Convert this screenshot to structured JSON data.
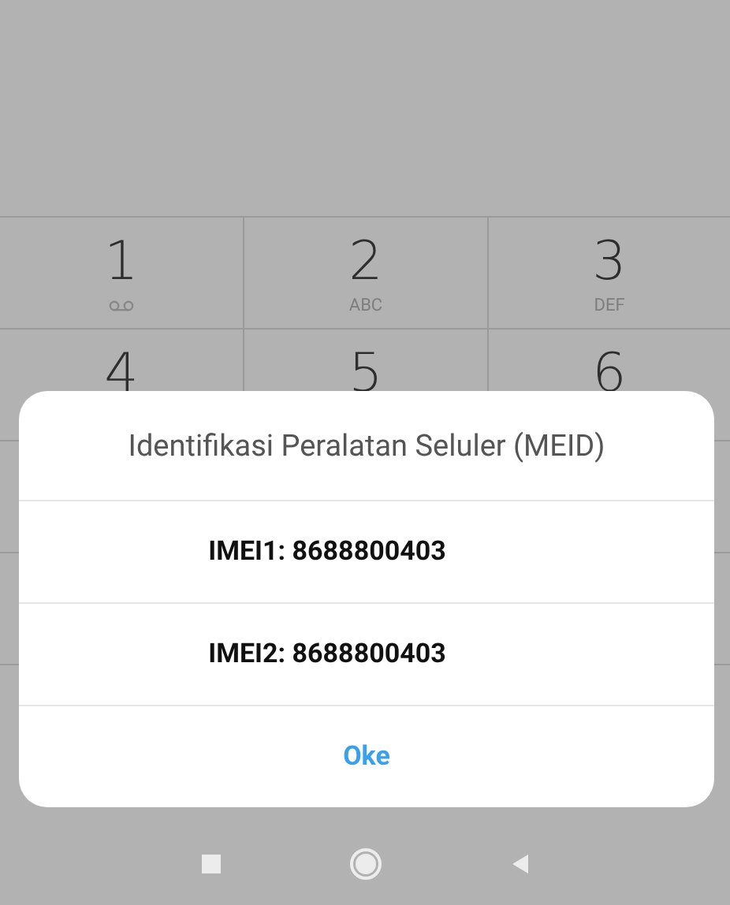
{
  "keypad": {
    "keys": [
      {
        "digit": "1",
        "kind": "voicemail"
      },
      {
        "digit": "2",
        "kind": "letters",
        "letters": "ABC"
      },
      {
        "digit": "3",
        "kind": "letters",
        "letters": "DEF"
      },
      {
        "digit": "4",
        "kind": "plain"
      },
      {
        "digit": "5",
        "kind": "plain"
      },
      {
        "digit": "6",
        "kind": "plain"
      }
    ]
  },
  "dialog": {
    "title": "Identifikasi Peralatan Seluler (MEID)",
    "items": [
      "IMEI1: 8688800403",
      "IMEI2: 8688800403"
    ],
    "button": "Oke"
  },
  "nav_bar": {
    "buttons": [
      {
        "kind": "recents"
      },
      {
        "kind": "home"
      },
      {
        "kind": "back"
      }
    ]
  }
}
